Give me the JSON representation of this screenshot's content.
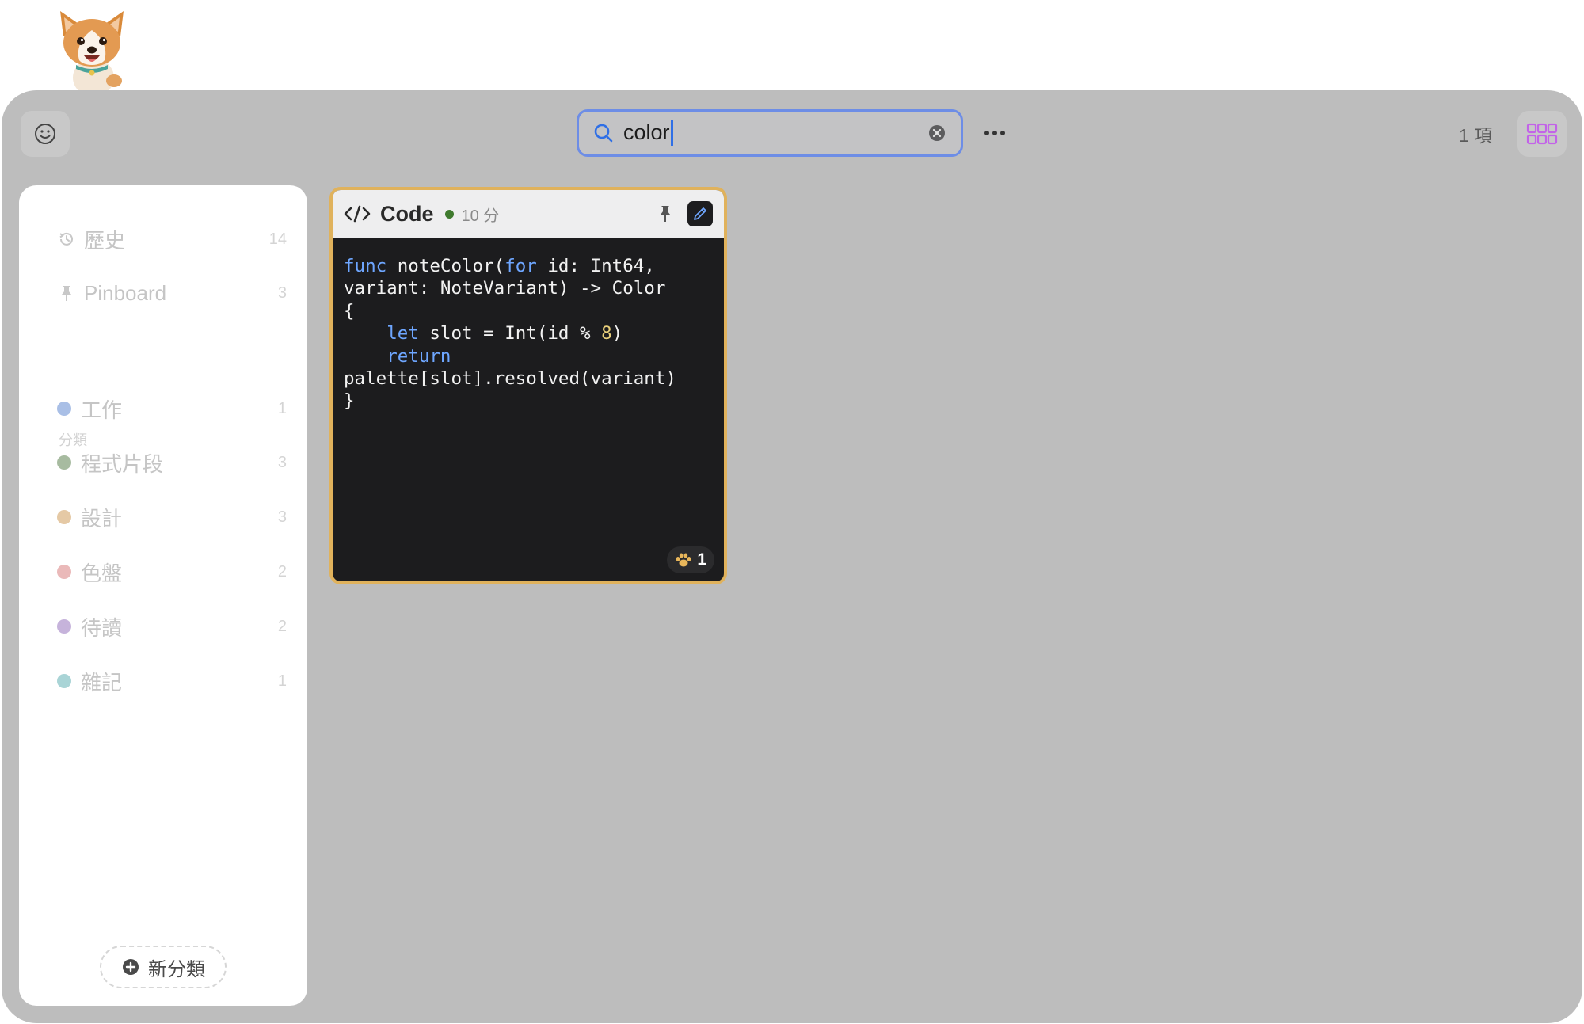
{
  "toolbar": {
    "search_value": "color",
    "more_label": "···",
    "result_count": "1 項"
  },
  "sidebar": {
    "history": {
      "label": "歷史",
      "count": "14"
    },
    "pinboard": {
      "label": "Pinboard",
      "count": "3"
    },
    "section_label": "分類",
    "categories": [
      {
        "label": "工作",
        "count": "1",
        "color": "#a9bfe6"
      },
      {
        "label": "程式片段",
        "count": "3",
        "color": "#a7bba0"
      },
      {
        "label": "設計",
        "count": "3",
        "color": "#e5c9a5"
      },
      {
        "label": "色盤",
        "count": "2",
        "color": "#eab9b9"
      },
      {
        "label": "待讀",
        "count": "2",
        "color": "#c6b3db"
      },
      {
        "label": "雜記",
        "count": "1",
        "color": "#a9d4d6"
      }
    ],
    "new_category_label": "新分類"
  },
  "card": {
    "type_label": "Code",
    "time": "10 分",
    "badge_count": "1",
    "code_lines": [
      "func noteColor(for id: Int64,",
      "variant: NoteVariant) -> Color",
      "{",
      "    let slot = Int(id % 8)",
      "    return",
      "palette[slot].resolved(variant)",
      "}"
    ]
  },
  "colors": {
    "window_bg": "#bdbdbd",
    "search_focus": "#6d8de6",
    "card_border": "#e0b25c",
    "code_keyword": "#6ea6ff",
    "code_number": "#e8cf7a",
    "view_toggle": "#c263e8"
  },
  "icons": {
    "emoji": "smiley-icon",
    "search": "magnifier-icon",
    "clear": "x-circle-icon",
    "view": "grid-icon",
    "history": "clock-icon",
    "pinboard": "pin-icon",
    "code": "code-brackets-icon",
    "edit": "pencil-icon",
    "badge": "paw-icon"
  }
}
